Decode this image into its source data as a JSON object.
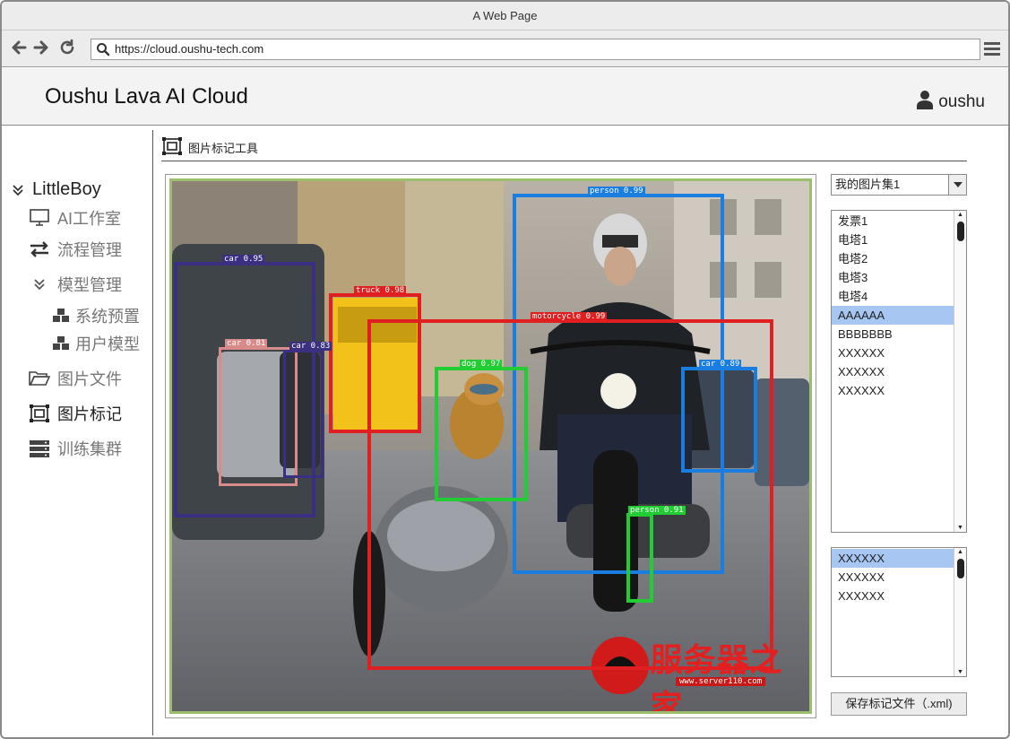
{
  "browser": {
    "window_title": "A Web Page",
    "url": "https://cloud.oushu-tech.com"
  },
  "header": {
    "app_title": "Oushu Lava AI Cloud",
    "user_name": "oushu"
  },
  "sidebar": {
    "root": "LittleBoy",
    "items": [
      {
        "label": "AI工作室",
        "icon": "monitor-icon"
      },
      {
        "label": "流程管理",
        "icon": "swap-arrows-icon"
      },
      {
        "label": "模型管理",
        "icon": "chevron-double-down-icon"
      },
      {
        "label": "系统预置",
        "icon": "cubes-icon"
      },
      {
        "label": "用户模型",
        "icon": "cubes-icon"
      },
      {
        "label": "图片文件",
        "icon": "folder-open-icon"
      },
      {
        "label": "图片标记",
        "icon": "annotate-icon"
      },
      {
        "label": "训练集群",
        "icon": "server-icon"
      }
    ]
  },
  "tool": {
    "title": "图片标记工具"
  },
  "image": {
    "boxes": [
      {
        "label": "person 0.99",
        "color": "#1a7de0"
      },
      {
        "label": "car 0.95",
        "color": "#3a2f80"
      },
      {
        "label": "truck 0.98",
        "color": "#e02020"
      },
      {
        "label": "motorcycle 0.99",
        "color": "#e02020"
      },
      {
        "label": "car 0.81",
        "color": "#d98a8a"
      },
      {
        "label": "car 0.83",
        "color": "#3a2f80"
      },
      {
        "label": "dog 0.97",
        "color": "#22cc33"
      },
      {
        "label": "car 0.89",
        "color": "#1a7de0"
      },
      {
        "label": "person 0.91",
        "color": "#22cc33"
      }
    ],
    "watermark": "服务器之家",
    "watermark_url": "www.server110.com"
  },
  "right_panel": {
    "dataset_select": "我的图片集1",
    "image_list": [
      "发票1",
      "电塔1",
      "电塔2",
      "电塔3",
      "电塔4",
      "AAAAAA",
      "BBBBBBB",
      "XXXXXX",
      "XXXXXX",
      "XXXXXX"
    ],
    "image_list_selected": 5,
    "label_list": [
      "XXXXXX",
      "XXXXXX",
      "XXXXXX"
    ],
    "label_list_selected": 0,
    "save_button": "保存标记文件（.xml)"
  }
}
